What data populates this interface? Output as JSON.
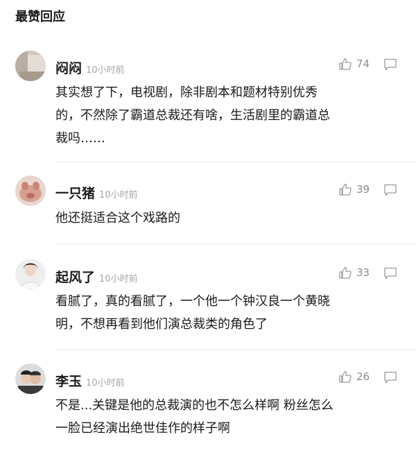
{
  "section": {
    "title": "最赞回应"
  },
  "comments": [
    {
      "user": "闷闷",
      "time": "10小时前",
      "likes": "74",
      "text": "其实想了下，电视剧，除非剧本和题材特别优秀\n的，不然除了霸道总裁还有啥，生活剧里的霸道总\n裁吗……"
    },
    {
      "user": "一只猪",
      "time": "10小时前",
      "likes": "39",
      "text": "他还挺适合这个戏路的"
    },
    {
      "user": "起风了",
      "time": "10小时前",
      "likes": "33",
      "text": "看腻了，真的看腻了，一个他一个钟汉良一个黄晓\n明，不想再看到他们演总裁类的角色了"
    },
    {
      "user": "李玉",
      "time": "10小时前",
      "likes": "26",
      "text": "不是...关键是他的总裁演的也不怎么样啊 粉丝怎么\n一脸已经演出绝世佳作的样子啊"
    }
  ],
  "icons": {
    "like": "thumbs-up-icon",
    "reply": "comment-bubble-icon"
  }
}
